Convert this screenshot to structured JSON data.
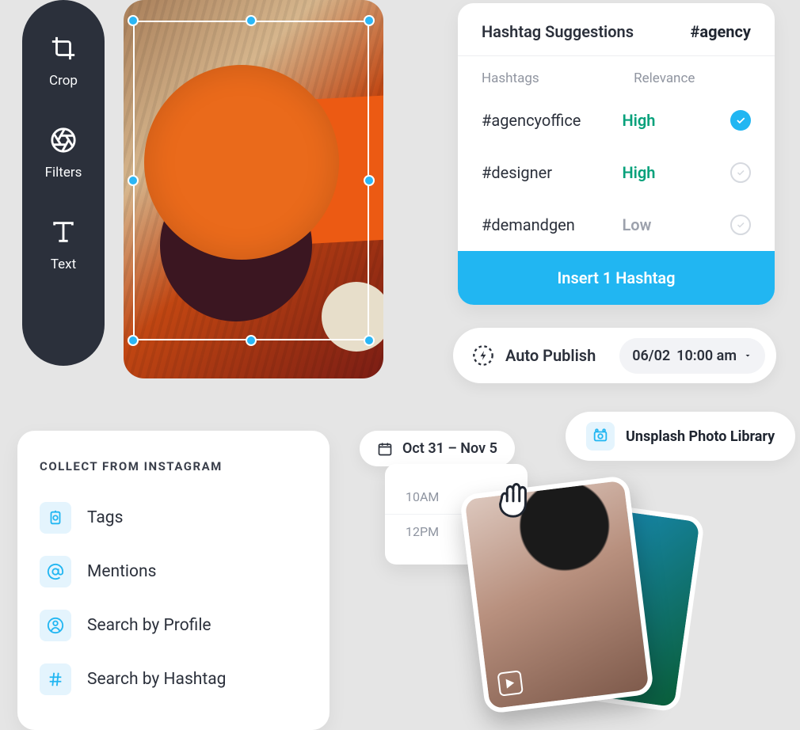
{
  "editor_tools": {
    "crop": "Crop",
    "filters": "Filters",
    "text": "Text"
  },
  "hashtag": {
    "title": "Hashtag Suggestions",
    "tag": "#agency",
    "col_hashtags": "Hashtags",
    "col_relevance": "Relevance",
    "rows": [
      {
        "name": "#agencyoffice",
        "relevance": "High",
        "selected": true
      },
      {
        "name": "#designer",
        "relevance": "High",
        "selected": false
      },
      {
        "name": "#demandgen",
        "relevance": "Low",
        "selected": false
      }
    ],
    "insert_label": "Insert 1 Hashtag"
  },
  "publish": {
    "label": "Auto Publish",
    "date": "06/02",
    "time": "10:00 am"
  },
  "unsplash": {
    "label": "Unsplash Photo Library"
  },
  "collect": {
    "heading": "Collect from Instagram",
    "items": [
      {
        "label": "Tags"
      },
      {
        "label": "Mentions"
      },
      {
        "label": "Search by Profile"
      },
      {
        "label": "Search by Hashtag"
      }
    ]
  },
  "date_range": {
    "label": "Oct 31 – Nov 5"
  },
  "schedule": {
    "slots": [
      "10AM",
      "12PM"
    ]
  }
}
